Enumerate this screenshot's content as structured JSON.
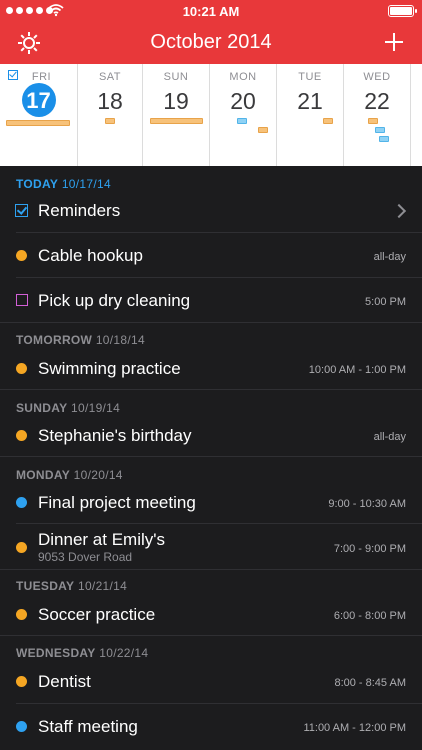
{
  "status_bar": {
    "time": "10:21 AM"
  },
  "header": {
    "title": "October 2014"
  },
  "week": [
    {
      "name": "FRI",
      "num": "17"
    },
    {
      "name": "SAT",
      "num": "18"
    },
    {
      "name": "SUN",
      "num": "19"
    },
    {
      "name": "MON",
      "num": "20"
    },
    {
      "name": "TUE",
      "num": "21"
    },
    {
      "name": "WED",
      "num": "22"
    }
  ],
  "colors": {
    "accent_red": "#e8383a",
    "today_blue": "#1a8fe8",
    "orange": "#f5a623",
    "blue": "#2ea1f0",
    "purple": "#d25fd6"
  },
  "sections": [
    {
      "day": "TODAY",
      "date": "10/17/14",
      "items": [
        {
          "title": "Reminders",
          "icon": "check",
          "chevron": true
        },
        {
          "title": "Cable hookup",
          "time": "all-day",
          "icon": "dot",
          "color": "#f5a623"
        },
        {
          "title": "Pick up dry cleaning",
          "time": "5:00 PM",
          "icon": "square",
          "color": "#d25fd6"
        }
      ]
    },
    {
      "day": "TOMORROW",
      "date": "10/18/14",
      "items": [
        {
          "title": "Swimming practice",
          "time": "10:00 AM - 1:00 PM",
          "icon": "dot",
          "color": "#f5a623"
        }
      ]
    },
    {
      "day": "SUNDAY",
      "date": "10/19/14",
      "items": [
        {
          "title": "Stephanie's birthday",
          "time": "all-day",
          "icon": "dot",
          "color": "#f5a623"
        }
      ]
    },
    {
      "day": "MONDAY",
      "date": "10/20/14",
      "items": [
        {
          "title": "Final project meeting",
          "time": "9:00 - 10:30 AM",
          "icon": "dot",
          "color": "#2ea1f0"
        },
        {
          "title": "Dinner at Emily's",
          "subtitle": "9053 Dover Road",
          "time": "7:00 - 9:00 PM",
          "icon": "dot",
          "color": "#f5a623"
        }
      ]
    },
    {
      "day": "TUESDAY",
      "date": "10/21/14",
      "items": [
        {
          "title": "Soccer practice",
          "time": "6:00 - 8:00 PM",
          "icon": "dot",
          "color": "#f5a623"
        }
      ]
    },
    {
      "day": "WEDNESDAY",
      "date": "10/22/14",
      "items": [
        {
          "title": "Dentist",
          "time": "8:00 - 8:45 AM",
          "icon": "dot",
          "color": "#f5a623"
        },
        {
          "title": "Staff meeting",
          "time": "11:00 AM - 12:00 PM",
          "icon": "dot",
          "color": "#2ea1f0"
        }
      ]
    }
  ]
}
